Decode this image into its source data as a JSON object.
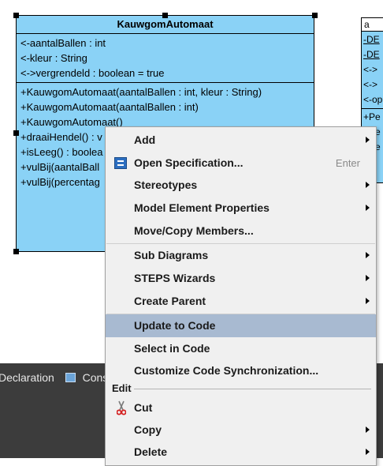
{
  "uml_class": {
    "name": "KauwgomAutomaat",
    "attributes": [
      "<-aantalBallen : int",
      "<-kleur : String",
      "<->vergrendeld : boolean = true"
    ],
    "operations": [
      "+KauwgomAutomaat(aantalBallen : int, kleur : String)",
      "+KauwgomAutomaat(aantalBallen : int)",
      "+KauwgomAutomaat()",
      "+draaiHendel() : v",
      "+isLeeg() : boolea",
      "+vulBij(aantalBall",
      "+vulBij(percentag"
    ]
  },
  "uml_class_2": {
    "name": "a",
    "attributes": [
      "-DE",
      "-DE",
      "<->",
      "<->",
      "<-op"
    ],
    "operations": [
      "+Pe",
      "+Pe",
      "+Pe",
      "ma"
    ]
  },
  "bottom_tabs": {
    "declaration": "Declaration",
    "console": "Cons"
  },
  "context_menu": {
    "items": {
      "add": "Add",
      "open_spec": "Open Specification...",
      "open_spec_shortcut": "Enter",
      "stereotypes": "Stereotypes",
      "model_props": "Model Element Properties",
      "move_copy": "Move/Copy Members...",
      "sub_diagrams": "Sub Diagrams",
      "steps": "STEPS Wizards",
      "create_parent": "Create Parent",
      "update_code": "Update to Code",
      "select_code": "Select in Code",
      "customize_sync": "Customize Code Synchronization...",
      "cut": "Cut",
      "copy": "Copy",
      "delete": "Delete"
    },
    "group_edit": "Edit"
  },
  "colors": {
    "class_fill": "#8ad2f6",
    "menu_bg": "#f0f0f0",
    "menu_hover": "#a8bad1",
    "bottom_bar": "#3c3c3c"
  }
}
